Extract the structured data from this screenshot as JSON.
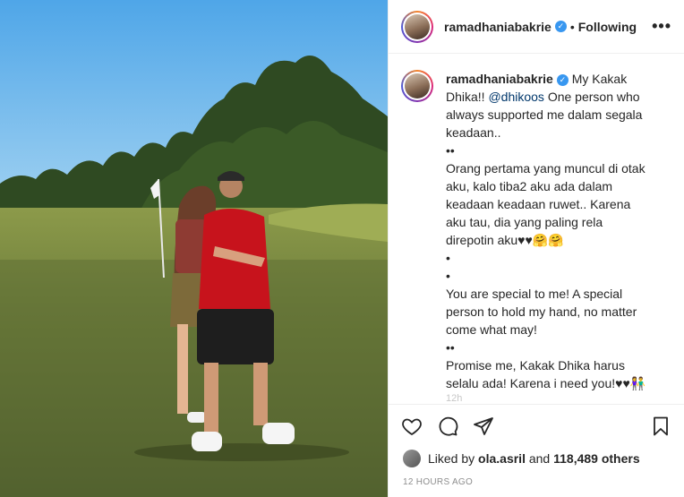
{
  "post": {
    "username": "ramadhaniabakrie",
    "verified_icon": "verified-badge-icon",
    "separator": "•",
    "follow_status": "Following",
    "more_icon": "more-options-icon",
    "more_label": "•••"
  },
  "caption": {
    "username": "ramadhaniabakrie",
    "text_before_mention": "My Kakak Dhika!! ",
    "mention": "@dhikoos",
    "text_after_mention": " One person who always supported me dalam segala keadaan..\n••\nOrang pertama yang muncul di otak aku, kalo tiba2 aku ada dalam keadaan keadaan ruwet.. Karena aku tau, dia yang paling rela direpotin aku♥♥🤗🤗\n•\n•\nYou are special to me! A special person to hold my hand, no matter come what may!\n••\nPromise me, Kakak Dhika harus selalu ada! Karena i need you!♥♥👫",
    "faded_time": "12h"
  },
  "actions": {
    "like_icon": "heart-icon",
    "comment_icon": "comment-icon",
    "share_icon": "share-icon",
    "save_icon": "bookmark-icon"
  },
  "likes": {
    "prefix": "Liked by ",
    "liker": "ola.asril",
    "middle": " and ",
    "others": "118,489 others"
  },
  "timestamp": "12 HOURS AGO",
  "colors": {
    "accent_blue": "#3897f0",
    "mention": "#00376b",
    "border": "#efefef",
    "muted": "#8e8e8e"
  }
}
